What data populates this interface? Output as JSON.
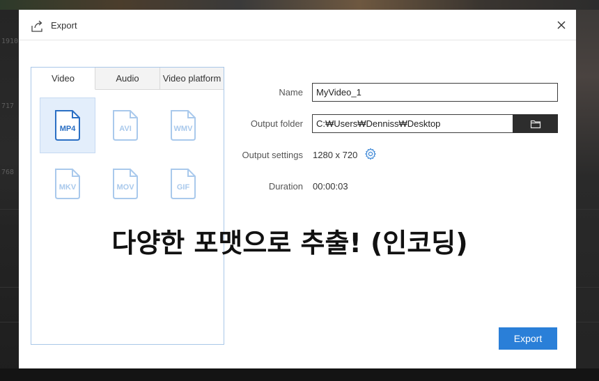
{
  "dialog": {
    "title": "Export",
    "close_icon": "close-icon",
    "export_icon": "export-icon"
  },
  "format_tabs": [
    {
      "label": "Video",
      "active": true
    },
    {
      "label": "Audio",
      "active": false
    },
    {
      "label": "Video platform",
      "active": false
    }
  ],
  "formats": [
    {
      "label": "MP4",
      "selected": true
    },
    {
      "label": "AVI",
      "selected": false
    },
    {
      "label": "WMV",
      "selected": false
    },
    {
      "label": "MKV",
      "selected": false
    },
    {
      "label": "MOV",
      "selected": false
    },
    {
      "label": "GIF",
      "selected": false
    }
  ],
  "form": {
    "name_label": "Name",
    "name_value": "MyVideo_1",
    "folder_label": "Output folder",
    "folder_value": "C:₩Users₩Denniss₩Desktop",
    "settings_label": "Output settings",
    "settings_value": "1280 x 720",
    "duration_label": "Duration",
    "duration_value": "00:00:03"
  },
  "export_button": "Export",
  "caption": "다양한 포맷으로 추출! (인코딩)",
  "background": {
    "left_numbers": [
      "1910",
      "717",
      "768"
    ]
  },
  "colors": {
    "accent": "#2a7fd8",
    "selected_bg": "#e3eefb",
    "icon_active": "#2a6fc4",
    "icon_inactive": "#a9c9ec"
  }
}
